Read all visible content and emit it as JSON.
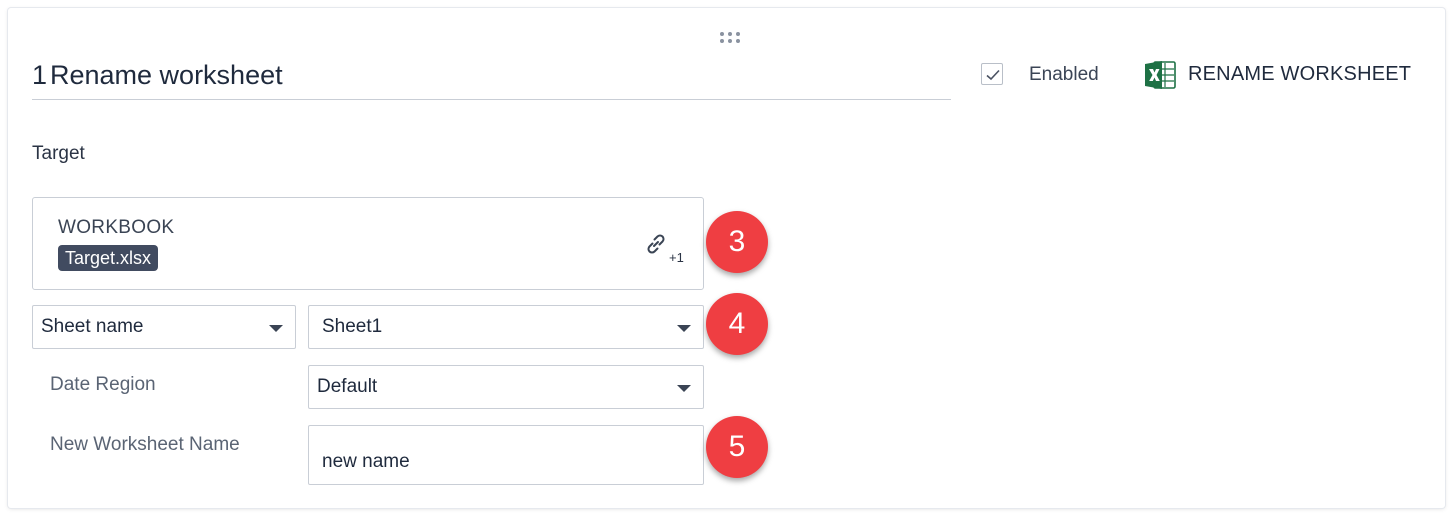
{
  "step": {
    "number": "1",
    "title": "Rename worksheet",
    "enabled_label": "Enabled",
    "enabled": true,
    "action_name": "RENAME WORKSHEET",
    "action_icon": "excel-icon"
  },
  "target": {
    "section_label": "Target",
    "workbook_label": "WORKBOOK",
    "workbook_value": "Target.xlsx",
    "link_count": "+1",
    "sheet_selector": "Sheet name",
    "sheet_value": "Sheet1",
    "date_region_label": "Date Region",
    "date_region_value": "Default",
    "new_name_label": "New Worksheet Name",
    "new_name_value": "new name"
  },
  "callouts": [
    "3",
    "4",
    "5"
  ],
  "colors": {
    "callout": "#ef3e42",
    "chip": "#414b60",
    "excel_green": "#1e7145"
  }
}
